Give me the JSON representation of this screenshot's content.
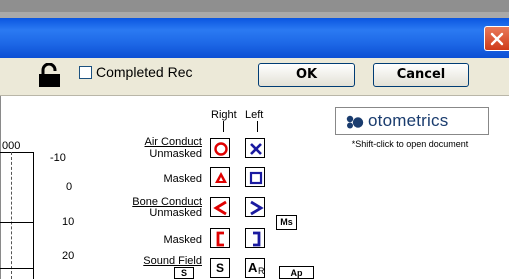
{
  "window": {
    "close_glyph": "close-icon"
  },
  "toolbar": {
    "lock_icon": "lock-icon",
    "checkbox_label": "Completed Rec",
    "checkbox_checked": false,
    "ok_label": "OK",
    "cancel_label": "Cancel"
  },
  "legend": {
    "right_label": "Right",
    "left_label": "Left",
    "air_conduct": "Air Conduct",
    "unmasked_1": "Unmasked",
    "masked_1": "Masked",
    "bone_conduct": "Bone Conduct",
    "unmasked_2": "Unmasked",
    "masked_2": "Masked",
    "sound_field": "Sound Field",
    "sf_s_button": "S",
    "sf_s_symbol": "S",
    "sf_a_symbol": "A",
    "sf_r_symbol": "R",
    "ms_button": "Ms",
    "partial_button": "Ap",
    "symbols": {
      "air_unmasked_right": "circle",
      "air_unmasked_left": "x",
      "air_masked_right": "triangle",
      "air_masked_left": "square",
      "bone_unmasked_right": "less-than",
      "bone_unmasked_left": "greater-than",
      "bone_masked_right": "left-bracket",
      "bone_masked_left": "right-bracket"
    },
    "colors": {
      "right": "#e00000",
      "left": "#1a1aa0"
    }
  },
  "graph": {
    "top_partial_label": "000",
    "y_ticks": [
      "-10",
      "0",
      "10",
      "20"
    ]
  },
  "otometrics": {
    "logo_text": "otometrics",
    "hint": "*Shift-click to open document"
  }
}
